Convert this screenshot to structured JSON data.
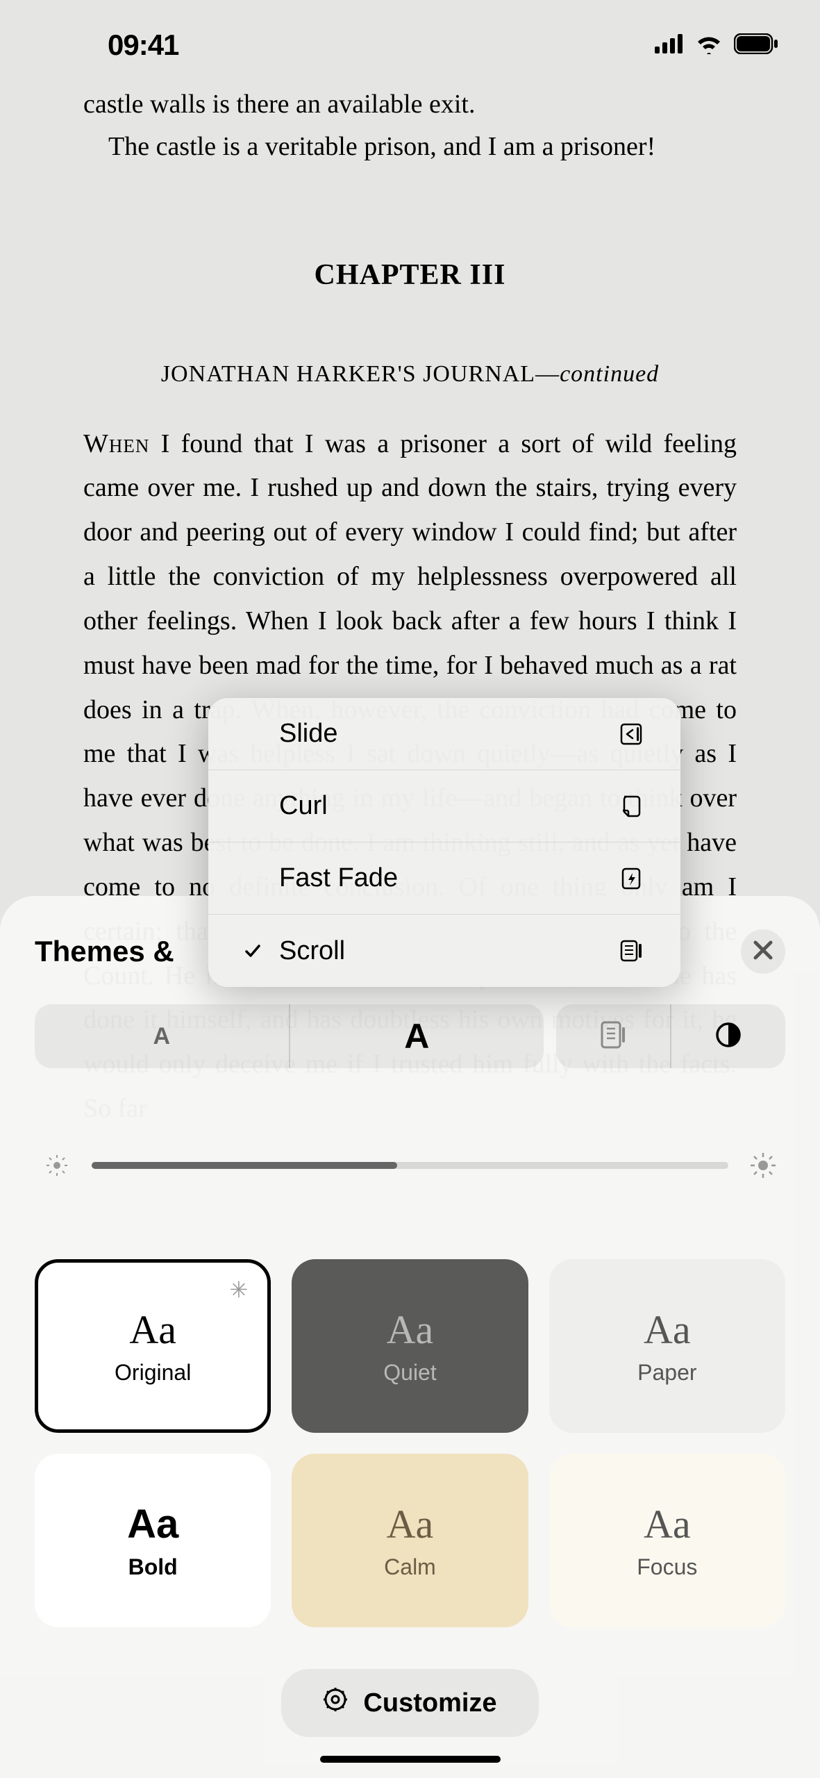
{
  "status": {
    "time": "09:41"
  },
  "reader": {
    "line1": "castle walls is there an available exit.",
    "line2": "The castle is a veritable prison, and I am a prisoner!",
    "chapter": "CHAPTER III",
    "journal_a": "JONATHAN HARKER'S JOURNAL—",
    "journal_b": "continued",
    "para_lead": "When",
    "para_rest": " I found that I was a prisoner a sort of wild feeling came over me. I rushed up and down the stairs, trying every door and peering out of every window I could find; but after a little the conviction of my helplessness overpowered all other feelings. When I look back after a few hours I think I must have been mad for the time, for I behaved much as a rat does in a trap. When, however, the conviction had come to me that I was helpless I sat down quietly—as quietly as I have ever done anything in my life—and began to think over what was best to be done. I am thinking still, and as yet have come to no definite conclusion. Of one thing only am I certain; that it is no use making my ideas known to the Count. He knows well that I am imprisoned; and as he has done it himself, and has doubtless his own motives for it, he would only deceive me if I trusted him fully with the facts. So far"
  },
  "popup": {
    "items": [
      {
        "label": "Slide",
        "icon": "slide",
        "checked": false
      },
      {
        "label": "Curl",
        "icon": "curl",
        "checked": false
      },
      {
        "label": "Fast Fade",
        "icon": "fastfade",
        "checked": false
      },
      {
        "label": "Scroll",
        "icon": "scroll",
        "checked": true
      }
    ]
  },
  "sheet": {
    "title": "Themes &",
    "font_small": "A",
    "font_big": "A",
    "brightness_pct": 48,
    "themes": [
      {
        "name": "Original",
        "key": "original",
        "starred": true
      },
      {
        "name": "Quiet",
        "key": "quiet",
        "starred": false
      },
      {
        "name": "Paper",
        "key": "paper",
        "starred": false
      },
      {
        "name": "Bold",
        "key": "bold",
        "starred": false
      },
      {
        "name": "Calm",
        "key": "calm",
        "starred": false
      },
      {
        "name": "Focus",
        "key": "focus",
        "starred": false
      }
    ],
    "customize_label": "Customize"
  }
}
